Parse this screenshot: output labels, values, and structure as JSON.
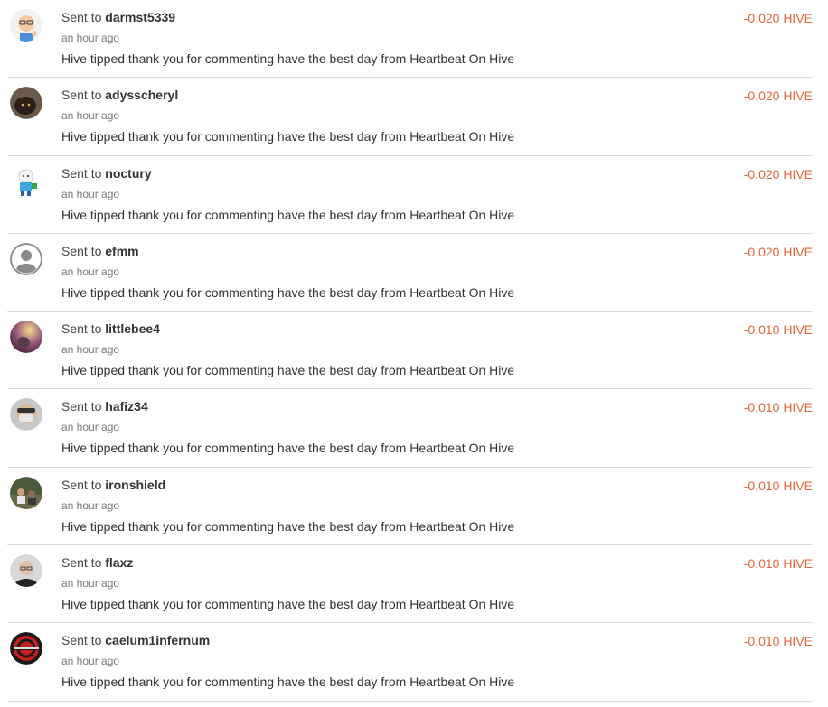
{
  "colors": {
    "amount": "#e3663c",
    "divider": "#dcdcdc",
    "muted": "#777777",
    "text": "#333333"
  },
  "transactions": [
    {
      "prefix": "Sent to",
      "user": "darmst5339",
      "time": "an hour ago",
      "memo": "Hive tipped thank you for commenting have the best day from Heartbeat On Hive",
      "amount": "-0.020 HIVE",
      "avatar_icon": "cartoon-man-avatar-icon"
    },
    {
      "prefix": "Sent to",
      "user": "adysscheryl",
      "time": "an hour ago",
      "memo": "Hive tipped thank you for commenting have the best day from Heartbeat On Hive",
      "amount": "-0.020 HIVE",
      "avatar_icon": "dark-cat-avatar-icon"
    },
    {
      "prefix": "Sent to",
      "user": "noctury",
      "time": "an hour ago",
      "memo": "Hive tipped thank you for commenting have the best day from Heartbeat On Hive",
      "amount": "-0.020 HIVE",
      "avatar_icon": "cartoon-character-avatar-icon"
    },
    {
      "prefix": "Sent to",
      "user": "efmm",
      "time": "an hour ago",
      "memo": "Hive tipped thank you for commenting have the best day from Heartbeat On Hive",
      "amount": "-0.020 HIVE",
      "avatar_icon": "default-user-avatar-icon"
    },
    {
      "prefix": "Sent to",
      "user": "littlebee4",
      "time": "an hour ago",
      "memo": "Hive tipped thank you for commenting have the best day from Heartbeat On Hive",
      "amount": "-0.010 HIVE",
      "avatar_icon": "photo-avatar-icon"
    },
    {
      "prefix": "Sent to",
      "user": "hafiz34",
      "time": "an hour ago",
      "memo": "Hive tipped thank you for commenting have the best day from Heartbeat On Hive",
      "amount": "-0.010 HIVE",
      "avatar_icon": "masked-face-avatar-icon"
    },
    {
      "prefix": "Sent to",
      "user": "ironshield",
      "time": "an hour ago",
      "memo": "Hive tipped thank you for commenting have the best day from Heartbeat On Hive",
      "amount": "-0.010 HIVE",
      "avatar_icon": "outdoor-photo-avatar-icon"
    },
    {
      "prefix": "Sent to",
      "user": "flaxz",
      "time": "an hour ago",
      "memo": "Hive tipped thank you for commenting have the best day from Heartbeat On Hive",
      "amount": "-0.010 HIVE",
      "avatar_icon": "bald-man-avatar-icon"
    },
    {
      "prefix": "Sent to",
      "user": "caelum1infernum",
      "time": "an hour ago",
      "memo": "Hive tipped thank you for commenting have the best day from Heartbeat On Hive",
      "amount": "-0.010 HIVE",
      "avatar_icon": "red-logo-avatar-icon"
    }
  ]
}
